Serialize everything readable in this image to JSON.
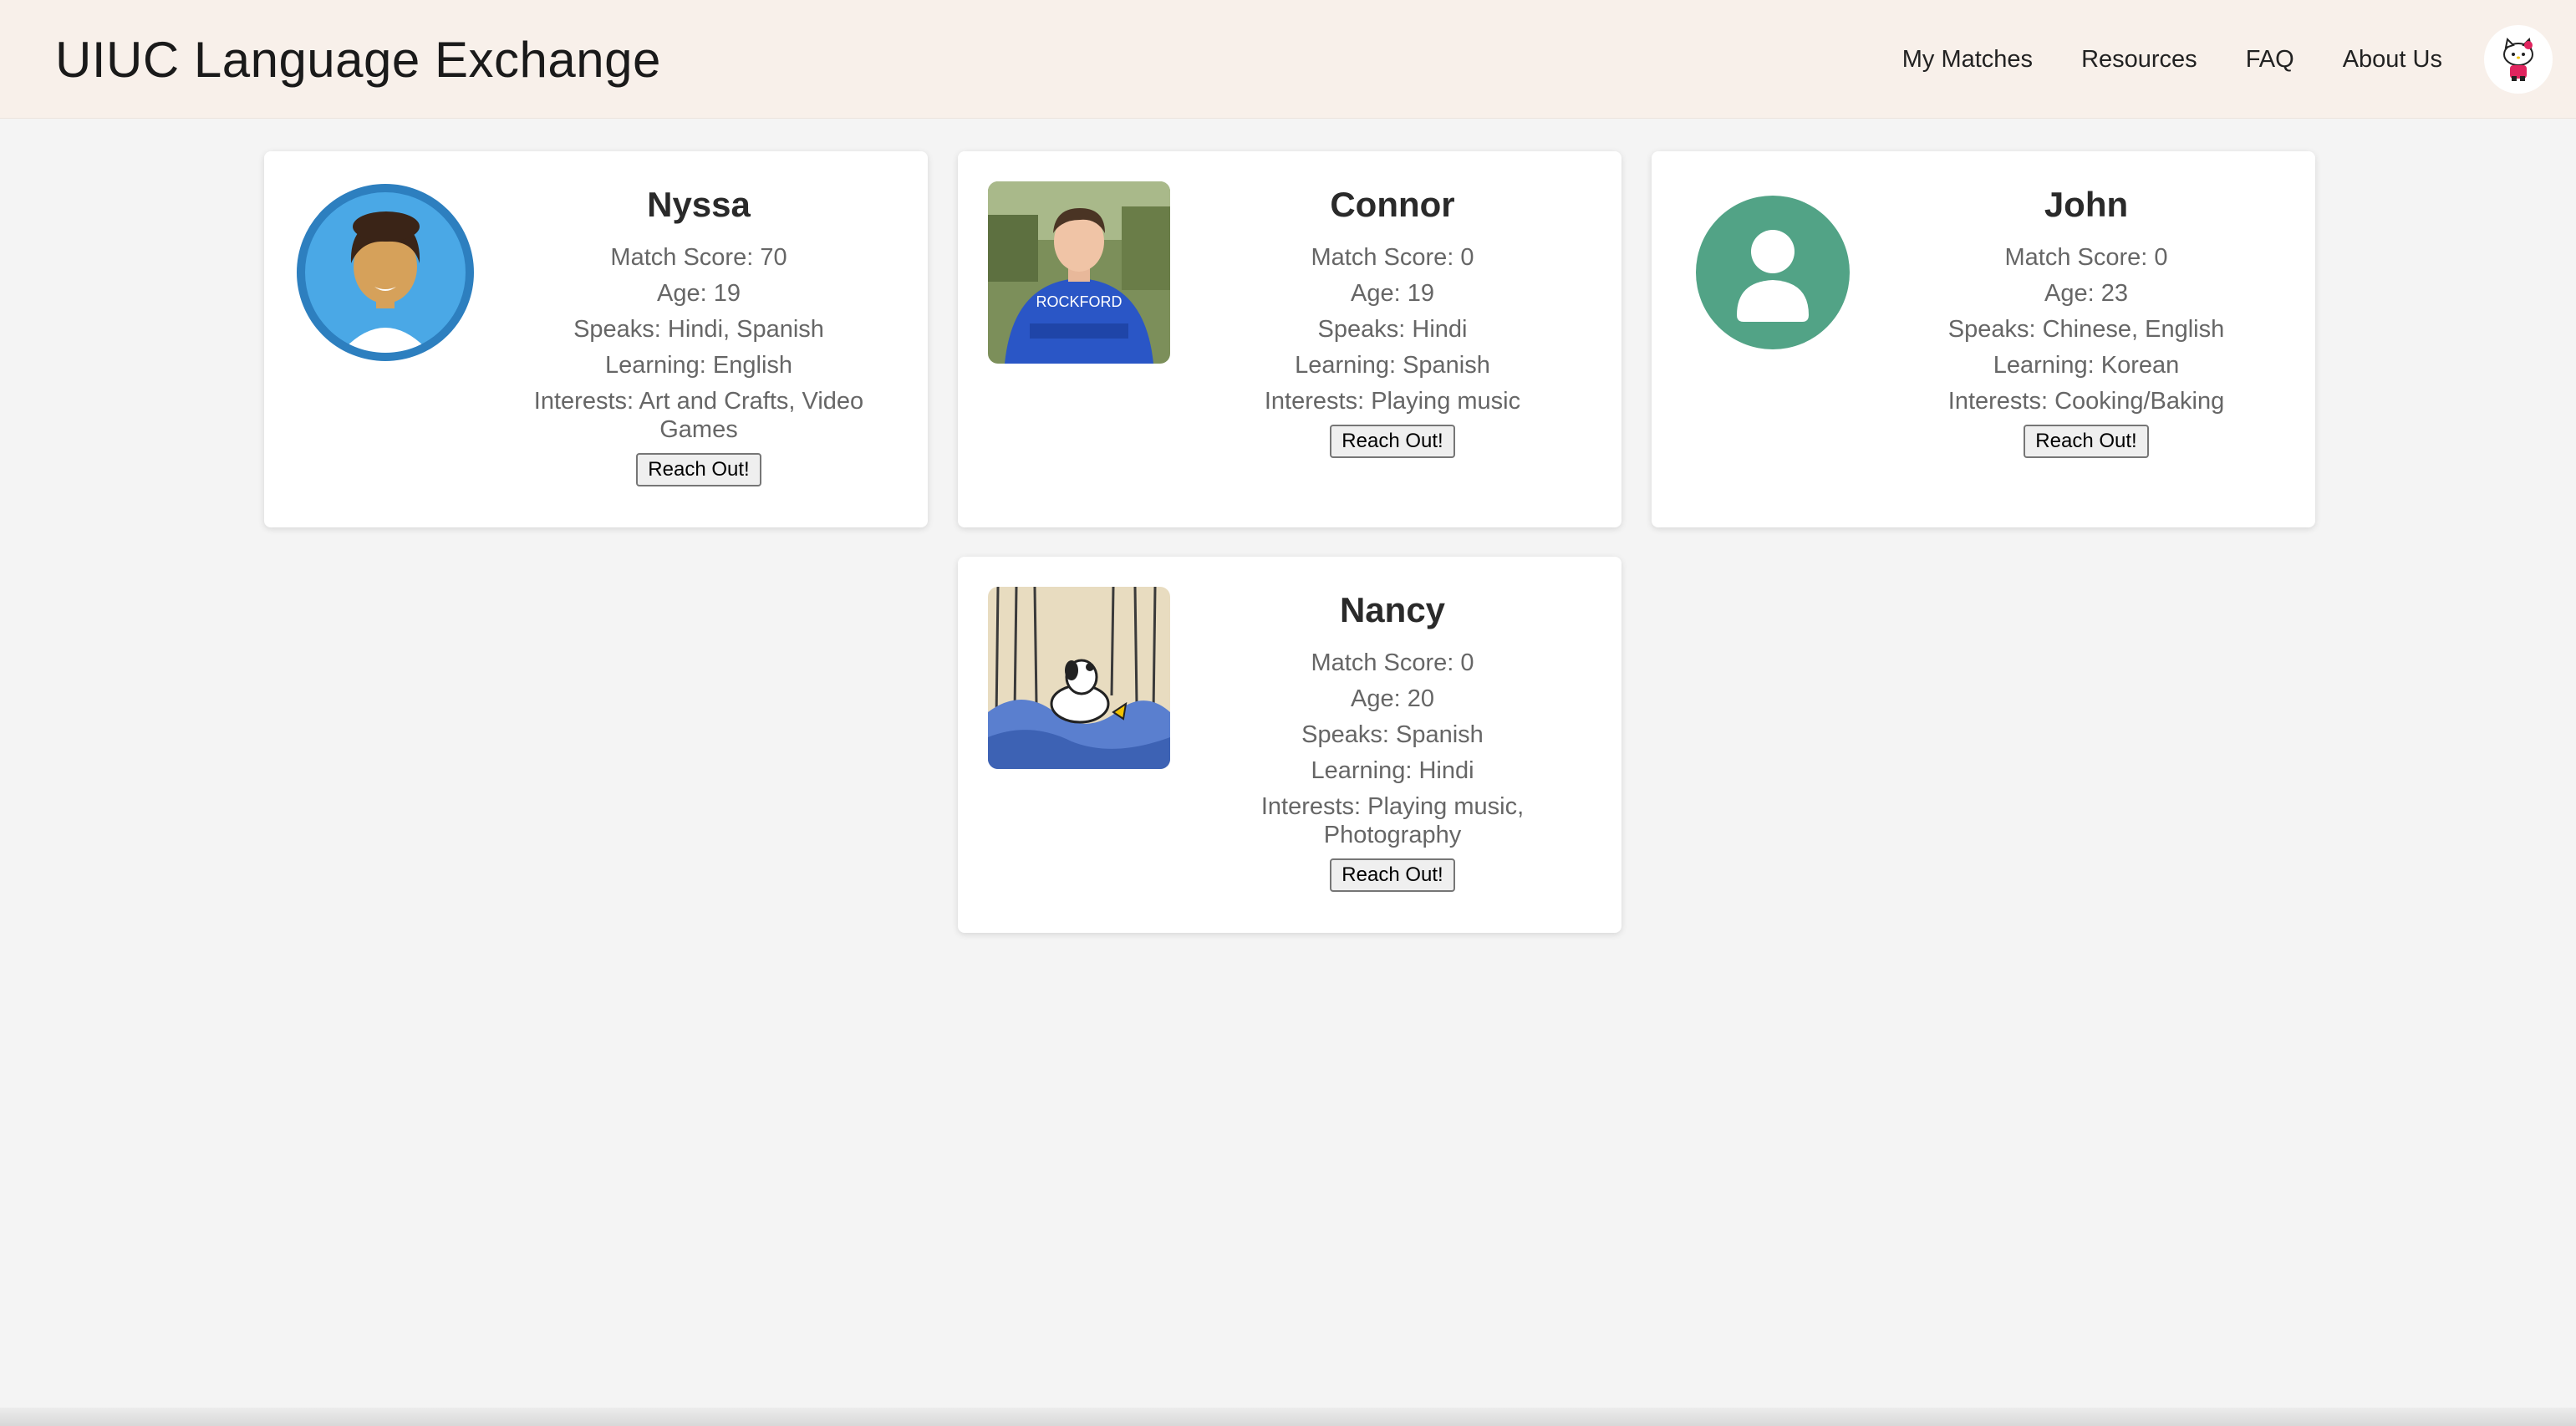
{
  "header": {
    "title": "UIUC Language Exchange",
    "nav": [
      "My Matches",
      "Resources",
      "FAQ",
      "About Us"
    ],
    "profile_icon": "hello-kitty-avatar"
  },
  "cards": [
    {
      "name": "Nyssa",
      "photo": "cartoon-person-avatar",
      "match_score": "Match Score: 70",
      "age": "Age: 19",
      "speaks": "Speaks: Hindi, Spanish",
      "learning": "Learning: English",
      "interests": "Interests: Art and Crafts, Video Games",
      "button": "Reach Out!"
    },
    {
      "name": "Connor",
      "photo": "student-photo",
      "match_score": "Match Score: 0",
      "age": "Age: 19",
      "speaks": "Speaks: Hindi",
      "learning": "Learning: Spanish",
      "interests": "Interests: Playing music",
      "button": "Reach Out!"
    },
    {
      "name": "John",
      "photo": "default-user-avatar",
      "match_score": "Match Score: 0",
      "age": "Age: 23",
      "speaks": "Speaks: Chinese, English",
      "learning": "Learning: Korean",
      "interests": "Interests: Cooking/Baking",
      "button": "Reach Out!"
    },
    {
      "name": "Nancy",
      "photo": "snoopy-illustration",
      "match_score": "Match Score: 0",
      "age": "Age: 20",
      "speaks": "Speaks: Spanish",
      "learning": "Learning: Hindi",
      "interests": "Interests: Playing music, Photography",
      "button": "Reach Out!"
    }
  ],
  "colors": {
    "header_bg": "#f8f0ea",
    "page_bg": "#f4f4f4",
    "john_avatar": "#52a386",
    "nyssa_avatar": "#3a8fd0"
  }
}
